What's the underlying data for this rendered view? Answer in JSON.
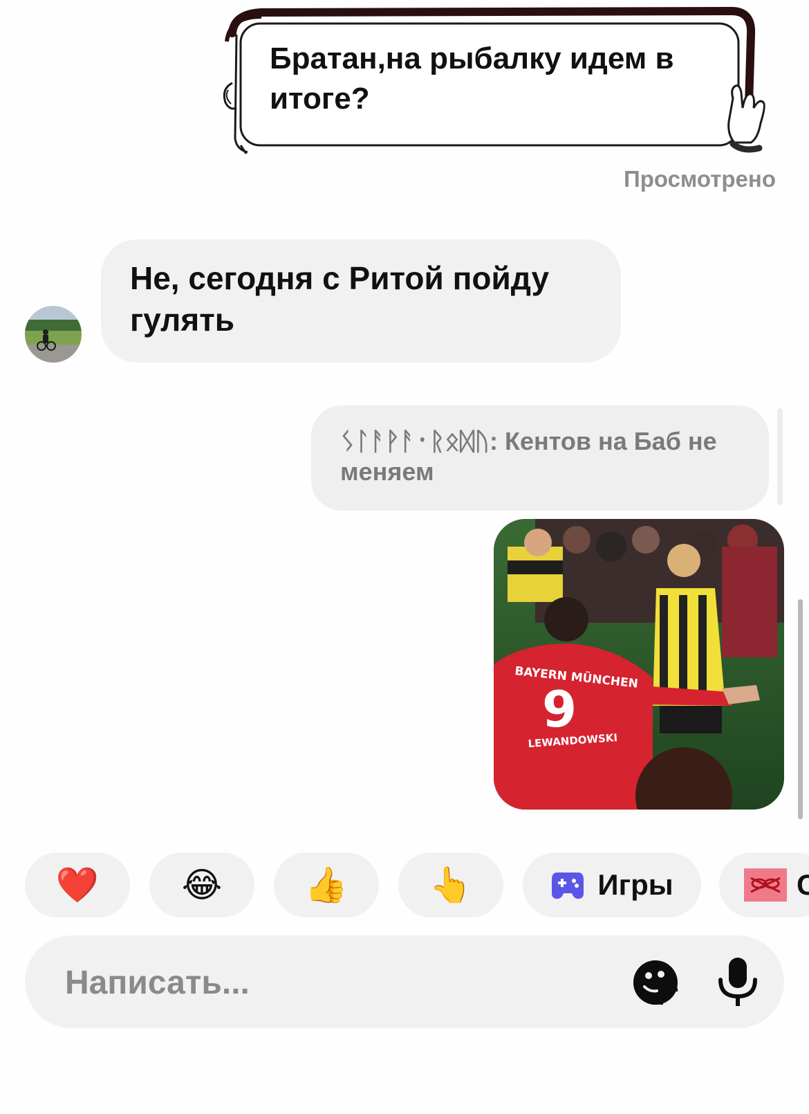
{
  "conversation": {
    "outgoing_message": "Братан,на рыбалку идем в итоге?",
    "seen_status": "Просмотрено",
    "incoming_message": "Не, сегодня с Ритой пойду гулять",
    "reply_quote": {
      "author": "ᛊᛚᚨᚹᚨ᛫ᚱᛟᛞᚢ",
      "text": "Кентов на Баб не меняем"
    },
    "photo": {
      "name_on_jersey": "LEWANDOWSKI",
      "number_on_jersey": "9",
      "club_on_jersey": "BAYERN MÜNCHEN"
    }
  },
  "quick_replies": [
    {
      "emoji": "❤️",
      "icon": "heart"
    },
    {
      "emoji": "😂",
      "icon": "tears-of-joy"
    },
    {
      "emoji": "👍",
      "icon": "thumbs-up"
    },
    {
      "emoji": "👆",
      "icon": "pointing-up"
    },
    {
      "label": "Игры",
      "icon": "gamepad"
    },
    {
      "label": "С",
      "icon": "gift"
    }
  ],
  "composer": {
    "placeholder": "Написать...",
    "sticker_icon": "sticker-icon",
    "mic_icon": "microphone-icon"
  },
  "colors": {
    "bubble": "#f1f1f1",
    "secondary_text": "#8e8e8e",
    "gamepad": "#5b57e6",
    "gift": "#f06b7d"
  }
}
